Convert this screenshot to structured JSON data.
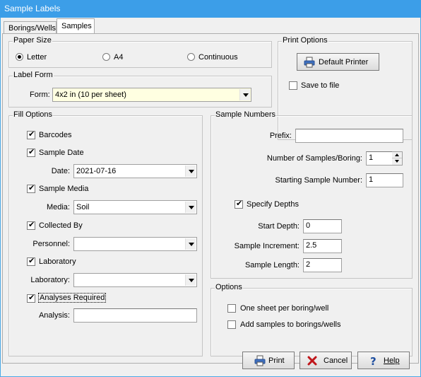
{
  "window": {
    "title": "Sample Labels"
  },
  "tabs": [
    "Borings/Wells",
    "Samples"
  ],
  "paper_size": {
    "legend": "Paper Size",
    "options": [
      {
        "label": "Letter",
        "selected": true
      },
      {
        "label": "A4",
        "selected": false
      },
      {
        "label": "Continuous",
        "selected": false
      }
    ]
  },
  "print_options": {
    "legend": "Print Options",
    "printer_button": "Default Printer",
    "save_to_file": {
      "label": "Save to file",
      "checked": false
    }
  },
  "label_form": {
    "legend": "Label Form",
    "form_label": "Form:",
    "form_value": "4x2 in (10 per sheet)"
  },
  "fill_options": {
    "legend": "Fill Options",
    "barcodes": {
      "label": "Barcodes",
      "checked": true
    },
    "sample_date": {
      "label": "Sample Date",
      "checked": true
    },
    "date_label": "Date:",
    "date_value": "2021-07-16",
    "sample_media": {
      "label": "Sample Media",
      "checked": true
    },
    "media_label": "Media:",
    "media_value": "Soil",
    "collected_by": {
      "label": "Collected By",
      "checked": true
    },
    "personnel_label": "Personnel:",
    "personnel_value": "",
    "laboratory": {
      "label": "Laboratory",
      "checked": true
    },
    "laboratory_label": "Laboratory:",
    "laboratory_value": "",
    "analyses_required": {
      "label": "Analyses Required",
      "checked": true
    },
    "analysis_label": "Analysis:",
    "analysis_value": ""
  },
  "sample_numbers": {
    "legend": "Sample Numbers",
    "prefix_label": "Prefix:",
    "prefix_value": "",
    "num_samples_label": "Number of Samples/Boring:",
    "num_samples_value": "1",
    "starting_label": "Starting Sample Number:",
    "starting_value": "1",
    "specify_depths": {
      "label": "Specify Depths",
      "checked": true
    },
    "start_depth_label": "Start Depth:",
    "start_depth_value": "0",
    "increment_label": "Sample Increment:",
    "increment_value": "2.5",
    "length_label": "Sample Length:",
    "length_value": "2"
  },
  "options": {
    "legend": "Options",
    "one_sheet": {
      "label": "One sheet per boring/well",
      "checked": false
    },
    "add_samples": {
      "label": "Add samples to borings/wells",
      "checked": false
    }
  },
  "buttons": {
    "print": "Print",
    "cancel": "Cancel",
    "help": "Help"
  },
  "colors": {
    "titlebar": "#3c9ee8",
    "form_highlight": "#ffffe1",
    "dialog_bg": "#f0f0f0"
  }
}
